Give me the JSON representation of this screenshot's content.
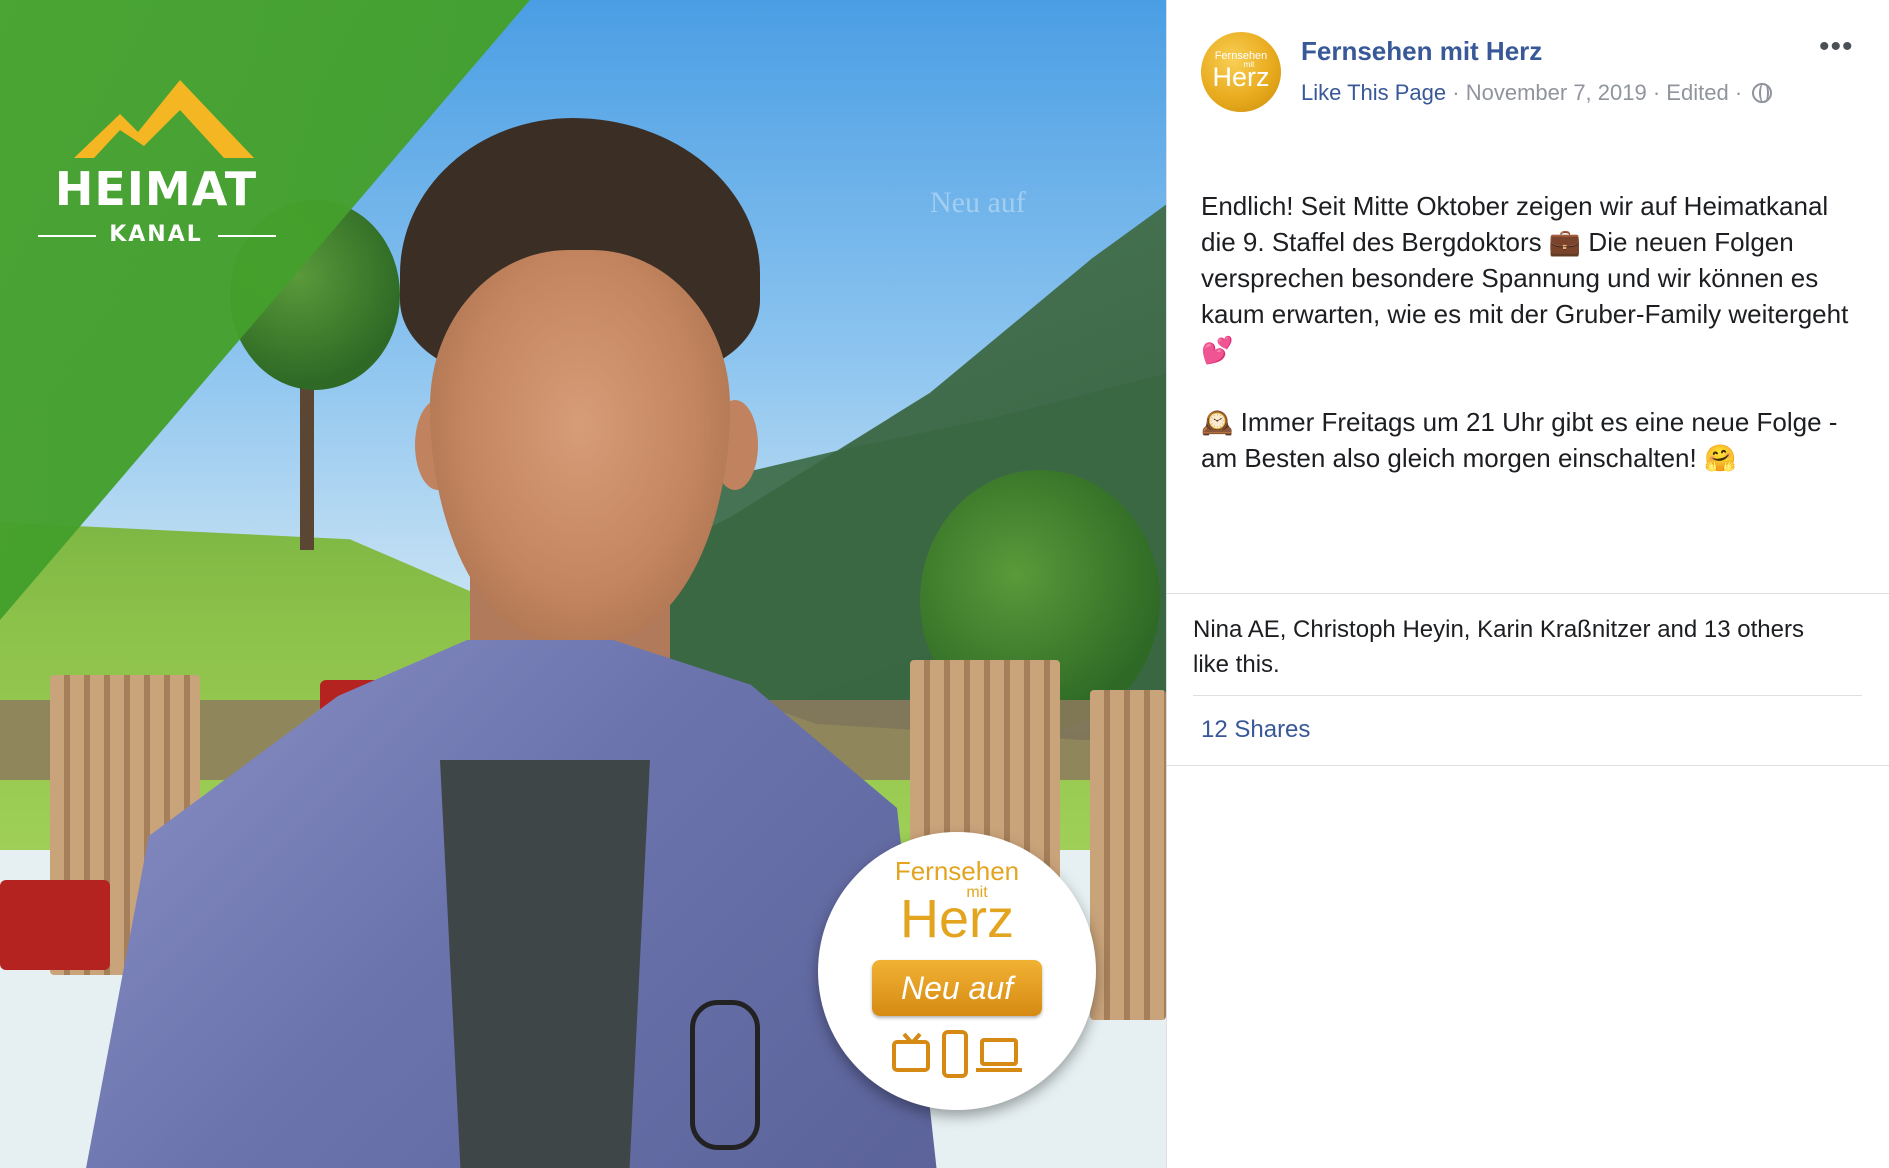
{
  "image": {
    "logo": {
      "title": "HEIMAT",
      "subtitle": "KANAL"
    },
    "watermark": "Neu auf",
    "badge": {
      "line1": "Fernsehen",
      "line2": "mit",
      "line3": "Herz",
      "button": "Neu auf",
      "devices": [
        "tv-icon",
        "phone-icon",
        "laptop-icon"
      ]
    }
  },
  "post": {
    "page_name": "Fernsehen mit Herz",
    "avatar": {
      "line1": "Fernsehen",
      "line2": "mit",
      "line3": "Herz"
    },
    "meta": {
      "like_page": "Like This Page",
      "separator": "·",
      "date": "November 7, 2019",
      "edited": "Edited",
      "privacy_icon": "globe-icon"
    },
    "more_menu": "•••",
    "paragraph1": "Endlich! Seit Mitte Oktober zeigen wir auf Heimatkanal die 9. Staffel des Bergdoktors 💼 Die neuen Folgen versprechen besondere Spannung und wir können es kaum erwarten, wie es mit der Gruber-Family weitergeht 💕",
    "paragraph2": "🕰️ Immer Freitags um 21 Uhr gibt es eine neue Folge - am Besten also gleich morgen einschalten! 🤗",
    "likes": "Nina AE, Christoph Heyin, Karin Kraßnitzer and 13 others like this.",
    "shares": "12 Shares"
  },
  "colors": {
    "link": "#385898",
    "muted": "#90949c",
    "green": "#4aa52d",
    "gold": "#e3a51f"
  }
}
